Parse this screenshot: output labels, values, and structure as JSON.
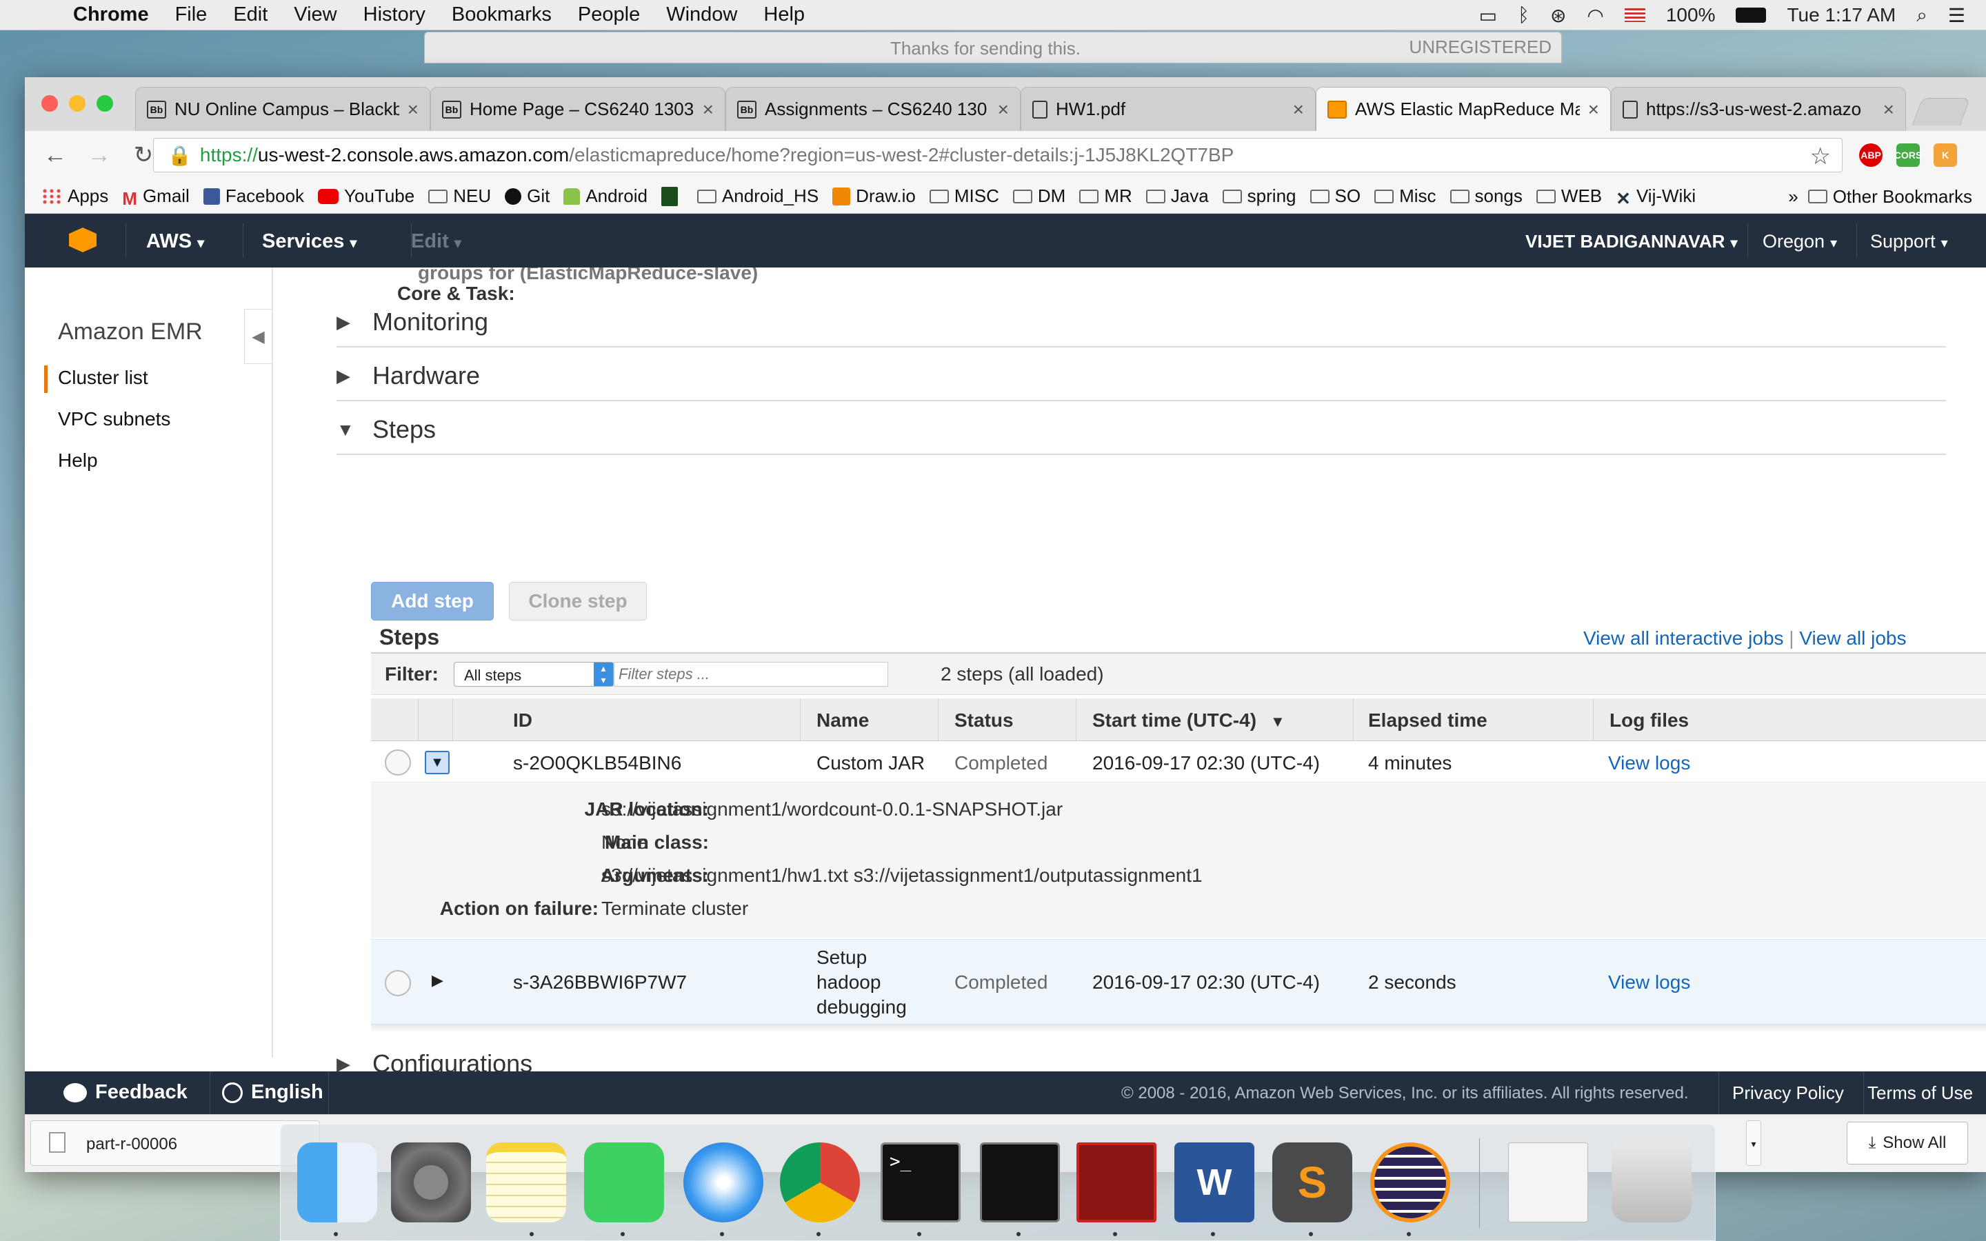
{
  "menubar": {
    "app": "Chrome",
    "menus": [
      "File",
      "Edit",
      "View",
      "History",
      "Bookmarks",
      "People",
      "Window",
      "Help"
    ],
    "battery": "100%",
    "clock": "Tue 1:17 AM"
  },
  "ghost_window": {
    "title": "Thanks for sending this.",
    "badge": "UNREGISTERED"
  },
  "tabs": [
    {
      "label": "NU Online Campus – Blackb",
      "icon": "Bb"
    },
    {
      "label": "Home Page – CS6240 1303",
      "icon": "Bb"
    },
    {
      "label": "Assignments – CS6240 130",
      "icon": "Bb"
    },
    {
      "label": "HW1.pdf",
      "icon": "document"
    },
    {
      "label": "AWS Elastic MapReduce Ma",
      "icon": "aws"
    },
    {
      "label": "https://s3-us-west-2.amazo",
      "icon": "document"
    }
  ],
  "address": {
    "scheme": "https://",
    "host": "us-west-2.console.aws.amazon.com",
    "path": "/elasticmapreduce/home?region=us-west-2#cluster-details:j-1J5J8KL2QT7BP"
  },
  "bookmarks": [
    "Apps",
    "Gmail",
    "Facebook",
    "YouTube",
    "NEU",
    "Git",
    "Android",
    "",
    "Android_HS",
    "Draw.io",
    "MISC",
    "DM",
    "MR",
    "Java",
    "spring",
    "SO",
    "Misc",
    "songs",
    "WEB",
    "Vij-Wiki"
  ],
  "bookmarks_overflow": "»",
  "bookmarks_other": "Other Bookmarks",
  "aws_nav": {
    "brand": "AWS",
    "services": "Services",
    "edit": "Edit",
    "user": "VIJET BADIGANNAVAR",
    "region": "Oregon",
    "support": "Support"
  },
  "sidebar": {
    "title": "Amazon EMR",
    "items": [
      "Cluster list",
      "VPC subnets",
      "Help"
    ]
  },
  "partial_text": {
    "line1": "groups for  (ElasticMapReduce-slave)",
    "line2": "Core & Task:"
  },
  "sections": {
    "monitoring": "Monitoring",
    "hardware": "Hardware",
    "steps": "Steps",
    "configurations": "Configurations"
  },
  "steps_panel": {
    "add_step": "Add step",
    "clone_step": "Clone step",
    "heading": "Steps",
    "view_interactive": "View all interactive jobs",
    "view_all": "View all jobs",
    "filter_label": "Filter:",
    "filter_select": "All steps",
    "filter_placeholder": "Filter steps ...",
    "count": "2 steps (all loaded)",
    "columns": [
      "ID",
      "Name",
      "Status",
      "Start time (UTC-4)",
      "Elapsed time",
      "Log files"
    ],
    "rows": [
      {
        "id": "s-2O0QKLB54BIN6",
        "name": "Custom JAR",
        "status": "Completed",
        "start": "2016-09-17 02:30 (UTC-4)",
        "elapsed": "4 minutes",
        "logs": "View logs"
      },
      {
        "id": "s-3A26BBWI6P7W7",
        "name_lines": [
          "Setup",
          "hadoop",
          "debugging"
        ],
        "status": "Completed",
        "start": "2016-09-17 02:30 (UTC-4)",
        "elapsed": "2 seconds",
        "logs": "View logs"
      }
    ],
    "detail": {
      "jar_label": "JAR location:",
      "jar_value": "s3://vijetassignment1/wordcount-0.0.1-SNAPSHOT.jar",
      "main_label": "Main class:",
      "main_value": "None",
      "args_label": "Arguments:",
      "args_value": "s3://vijetassignment1/hw1.txt s3://vijetassignment1/outputassignment1",
      "fail_label": "Action on failure:",
      "fail_value": "Terminate cluster"
    }
  },
  "footer": {
    "feedback": "Feedback",
    "language": "English",
    "copyright": "© 2008 - 2016, Amazon Web Services, Inc. or its affiliates. All rights reserved.",
    "privacy": "Privacy Policy",
    "terms": "Terms of Use"
  },
  "downloads": {
    "file": "part-r-00006",
    "show_all": "Show All"
  },
  "colors": {
    "aws_nav": "#232f3e",
    "accent": "#e47911",
    "link": "#1166bb"
  }
}
